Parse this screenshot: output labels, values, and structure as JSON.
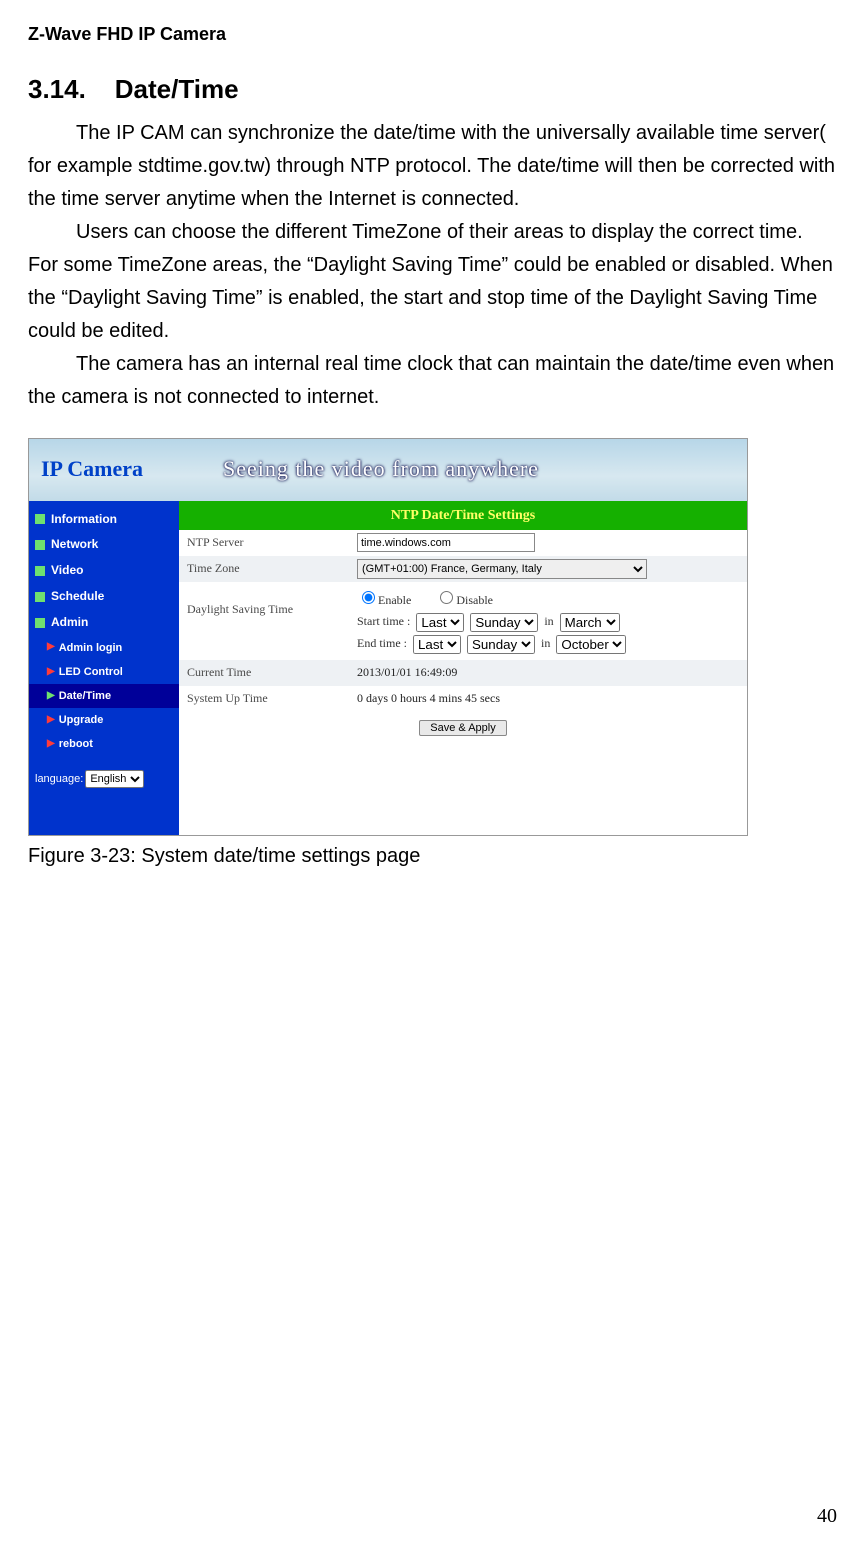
{
  "doc": {
    "header": "Z-Wave FHD IP Camera",
    "section_number": "3.14.",
    "section_title": "Date/Time",
    "paragraph1": "The IP CAM can synchronize the date/time with the universally available time server( for example stdtime.gov.tw) through NTP protocol. The date/time will then be corrected with the time server anytime when the Internet is connected.",
    "paragraph2": "Users can choose the different TimeZone of their areas to display the correct time. For some TimeZone areas, the “Daylight Saving Time” could be enabled or disabled. When the “Daylight Saving Time” is enabled, the start and stop time of the Daylight Saving Time could be edited.",
    "paragraph3": "The camera has an internal real time clock that can maintain the date/time even when the camera is not connected to internet.",
    "figure_caption": "Figure 3-23: System date/time settings page",
    "page_number": "40"
  },
  "screenshot": {
    "logo": "IP Camera",
    "tagline": "Seeing the video from anywhere",
    "sidebar": {
      "items": [
        "Information",
        "Network",
        "Video",
        "Schedule",
        "Admin"
      ],
      "sub_items": [
        "Admin login",
        "LED Control",
        "Date/Time",
        "Upgrade",
        "reboot"
      ],
      "active_sub": "Date/Time",
      "language_label": "language:",
      "language_value": "English"
    },
    "panel_title": "NTP Date/Time Settings",
    "rows": {
      "ntp_label": "NTP Server",
      "ntp_value": "time.windows.com",
      "tz_label": "Time Zone",
      "tz_value": "(GMT+01:00) France, Germany, Italy",
      "dst_label": "Daylight Saving Time",
      "enable": "Enable",
      "disable": "Disable",
      "start_label": "Start time :",
      "end_label": "End time  :",
      "ordinal": "Last",
      "weekday": "Sunday",
      "in": "in",
      "start_month": "March",
      "end_month": "October",
      "current_label": "Current Time",
      "current_value": "2013/01/01 16:49:09",
      "uptime_label": "System Up Time",
      "uptime_value": "0 days 0 hours 4 mins 45 secs",
      "save_button": "Save & Apply"
    }
  }
}
